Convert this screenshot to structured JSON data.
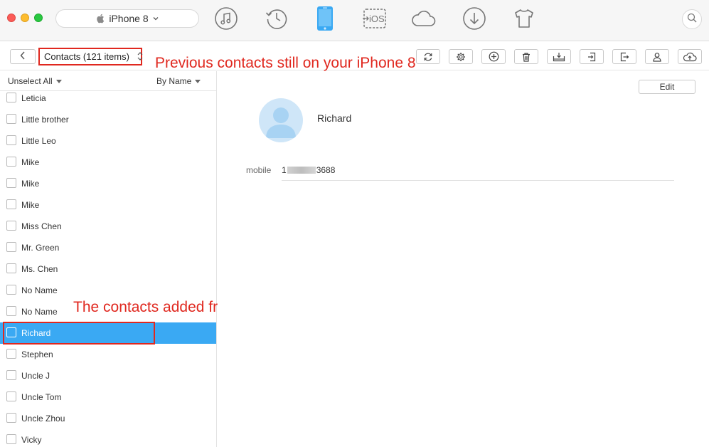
{
  "window": {
    "device_name": "iPhone 8",
    "top_icons": [
      "music-icon",
      "history-icon",
      "phone-manager-icon",
      "to-ios-icon",
      "cloud-icon",
      "download-icon",
      "tshirt-icon"
    ],
    "to_ios_label": "iOS",
    "accent_color": "#3aa9f3",
    "annotation_color": "#e0281f"
  },
  "toolbar": {
    "category_label": "Contacts (121 items)",
    "buttons": [
      "refresh-icon",
      "settings-icon",
      "add-icon",
      "delete-icon",
      "to-computer-icon",
      "import-icon",
      "export-icon",
      "contact-icon",
      "upload-cloud-icon"
    ]
  },
  "annotations": {
    "top": "Previous contacts still on your iPhone 8",
    "middle": "The contacts added from Mac"
  },
  "list": {
    "unselect_all": "Unselect All",
    "sort_label": "By Name",
    "contacts": [
      {
        "name": "Leticia",
        "selected": false
      },
      {
        "name": "Little brother",
        "selected": false
      },
      {
        "name": "Little Leo",
        "selected": false
      },
      {
        "name": "Mike",
        "selected": false
      },
      {
        "name": "Mike",
        "selected": false
      },
      {
        "name": "Mike",
        "selected": false
      },
      {
        "name": "Miss Chen",
        "selected": false
      },
      {
        "name": "Mr. Green",
        "selected": false
      },
      {
        "name": "Ms. Chen",
        "selected": false
      },
      {
        "name": "No Name",
        "selected": false
      },
      {
        "name": "No Name",
        "selected": false
      },
      {
        "name": "Richard",
        "selected": true
      },
      {
        "name": "Stephen",
        "selected": false
      },
      {
        "name": "Uncle J",
        "selected": false
      },
      {
        "name": "Uncle Tom",
        "selected": false
      },
      {
        "name": "Uncle Zhou",
        "selected": false
      },
      {
        "name": "Vicky",
        "selected": false
      }
    ]
  },
  "detail": {
    "edit_label": "Edit",
    "name": "Richard",
    "field_label": "mobile",
    "field_value_start": "1",
    "field_value_end": "3688"
  }
}
